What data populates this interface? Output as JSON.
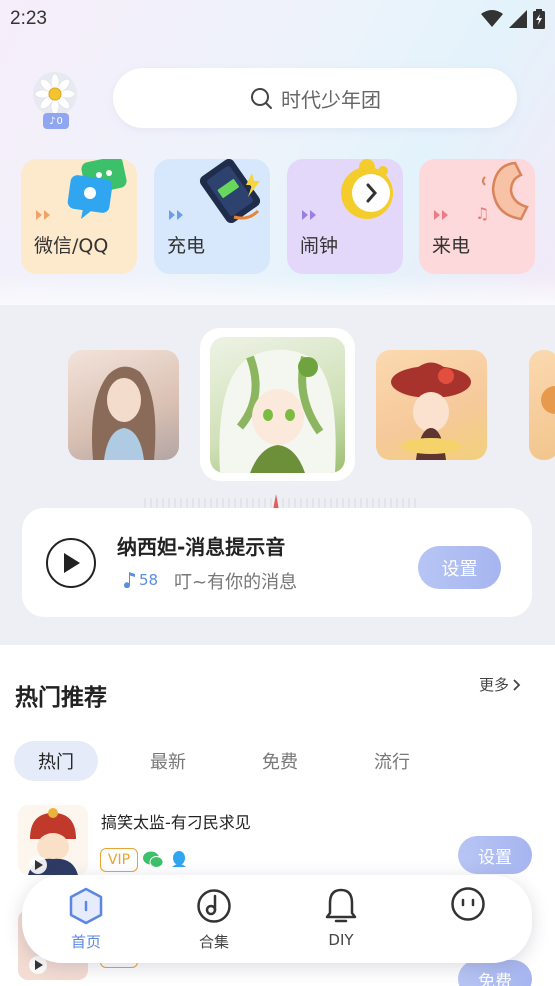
{
  "status": {
    "time": "2:23"
  },
  "profile": {
    "badge_count": "0"
  },
  "search": {
    "placeholder": "时代少年团"
  },
  "categories": [
    {
      "label": "微信/QQ",
      "bg": "#fde9cc",
      "dot": "#f0a36b"
    },
    {
      "label": "充电",
      "bg": "#d7e8fc",
      "dot": "#6d9de8"
    },
    {
      "label": "闹钟",
      "bg": "#e4d8fa",
      "dot": "#9b7ee4"
    },
    {
      "label": "来电",
      "bg": "#fdd9dc",
      "dot": "#ee7b86"
    }
  ],
  "player": {
    "title": "纳西妲-消息提示音",
    "count": "58",
    "desc": "叮~有你的消息",
    "set_label": "设置"
  },
  "hot": {
    "title": "热门推荐",
    "more": "更多",
    "tabs": [
      "热门",
      "最新",
      "免费",
      "流行"
    ],
    "rows": [
      {
        "name": "搞笑太监-有刁民求见",
        "vip": "VIP",
        "set": "设置"
      },
      {
        "name": "",
        "vip": "VIP",
        "set": "免费"
      }
    ]
  },
  "nav": {
    "items": [
      {
        "label": "首页"
      },
      {
        "label": "合集"
      },
      {
        "label": "DIY"
      },
      {
        "label": ""
      }
    ]
  },
  "colors": {
    "accent": "#5b86e5",
    "vip": "#e8a433",
    "button": "#a9b8f0"
  }
}
